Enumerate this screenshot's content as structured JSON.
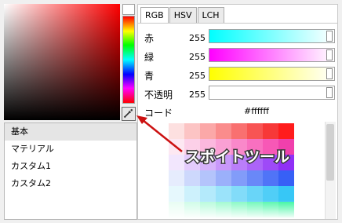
{
  "tabs": [
    {
      "label": "RGB",
      "active": true
    },
    {
      "label": "HSV",
      "active": false
    },
    {
      "label": "LCH",
      "active": false
    }
  ],
  "channels": [
    {
      "label": "赤",
      "value": "255",
      "gradient": [
        "#00ffff",
        "#ffffff"
      ]
    },
    {
      "label": "緑",
      "value": "255",
      "gradient": [
        "#ff00ff",
        "#ffffff"
      ]
    },
    {
      "label": "青",
      "value": "255",
      "gradient": [
        "#ffff00",
        "#ffffff"
      ]
    },
    {
      "label": "不透明",
      "value": "255",
      "gradient": [
        "#ffffff",
        "#ffffff"
      ]
    }
  ],
  "code": {
    "label": "コード",
    "value": "#ffffff"
  },
  "current_color": "#ffffff",
  "hue_color": "#ff0000",
  "palette_list": [
    "基本",
    "マテリアル",
    "カスタム1",
    "カスタム2"
  ],
  "selected_palette": "基本",
  "swatch_colors": [
    [
      "#ffffff",
      "#fde0e0",
      "#fcc4c4",
      "#fba8a8",
      "#fa8c8c",
      "#f97070",
      "#f85454",
      "#f73838",
      "#ff1c1c"
    ],
    [
      "#ffffff",
      "#fde8f2",
      "#fcd0e8",
      "#fbb8de",
      "#faa0d4",
      "#f988ca",
      "#f870c0",
      "#f758b6",
      "#f040ac"
    ],
    [
      "#ffffff",
      "#f2e6fd",
      "#e4ccfc",
      "#d6b2fb",
      "#c898fa",
      "#ba7ef9",
      "#ac64f8",
      "#9e4af7",
      "#9030f6"
    ],
    [
      "#ffffff",
      "#e6ecfd",
      "#cdd8fc",
      "#b4c4fb",
      "#9bb0fa",
      "#829cf9",
      "#6988f8",
      "#5074f7",
      "#3760f6"
    ],
    [
      "#ffffff",
      "#e6f8fd",
      "#cdf1fc",
      "#b4eafb",
      "#9be3fa",
      "#82dcf9",
      "#69d5f8",
      "#50cef7",
      "#37c7f6"
    ],
    [
      "#ffffff",
      "#e6fdf2",
      "#cdfce6",
      "#b4fbda",
      "#9bface",
      "#82f9c2",
      "#69f8b6",
      "#50f7aa",
      "#37f69e"
    ]
  ],
  "annotation": {
    "text": "スポイトツール",
    "color": "#cc1111"
  },
  "icons": {
    "eyedropper": "eyedropper-icon"
  }
}
